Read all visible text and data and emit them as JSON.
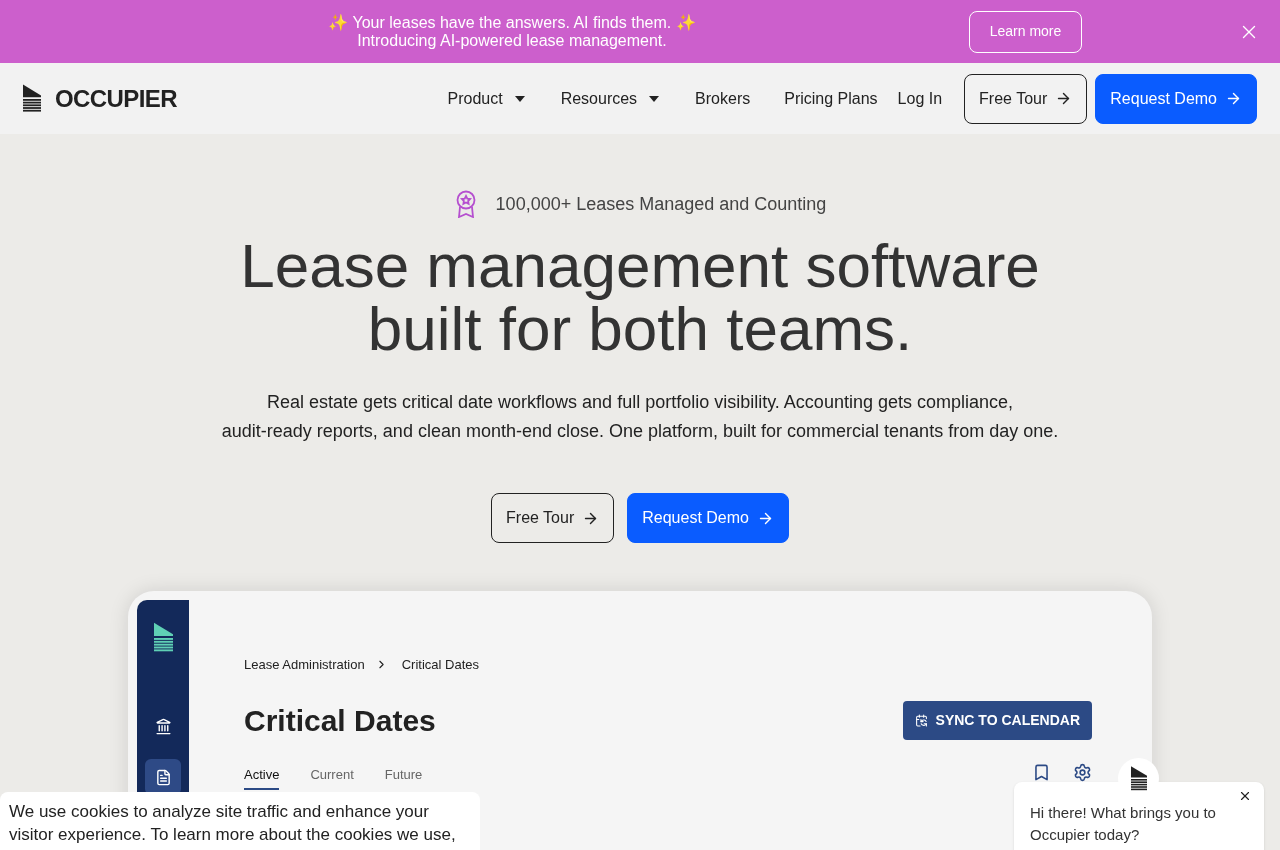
{
  "announcement": {
    "lines": [
      "✨ Your leases have the answers. AI finds them. ✨",
      "Introducing AI-powered lease management."
    ],
    "button": "Learn more"
  },
  "nav": {
    "brand": "OCCUPIER",
    "items": [
      {
        "label": "Product",
        "dropdown": true
      },
      {
        "label": "Resources",
        "dropdown": true
      },
      {
        "label": "Brokers",
        "dropdown": false
      },
      {
        "label": "Pricing Plans",
        "dropdown": false
      },
      {
        "label": "Log In",
        "dropdown": false
      }
    ],
    "buttons": [
      {
        "label": "Free Tour",
        "kind": "outline"
      },
      {
        "label": "Request Demo",
        "kind": "primary"
      }
    ]
  },
  "hero": {
    "badge": "100,000+ Leases Managed and Counting",
    "title_lines": [
      "Lease management software",
      "built for both teams."
    ],
    "subtitle_lines": [
      "Real estate gets critical date workflows and full portfolio visibility. Accounting gets compliance,",
      "audit-ready reports, and clean month-end close. One platform, built for commercial tenants from day one."
    ],
    "buttons": [
      {
        "label": "Free Tour",
        "kind": "outline"
      },
      {
        "label": "Request Demo",
        "kind": "primary"
      }
    ]
  },
  "app_preview": {
    "sidebar": [
      {
        "kind": "bank",
        "selected": false
      },
      {
        "kind": "document",
        "selected": true
      }
    ],
    "breadcrumb": [
      "Lease Administration",
      "Critical Dates"
    ],
    "title": "Critical Dates",
    "sync_button": "SYNC TO CALENDAR",
    "tabs": [
      {
        "label": "Active",
        "selected": true
      },
      {
        "label": "Current",
        "selected": false
      },
      {
        "label": "Future",
        "selected": false
      }
    ]
  },
  "cookie_notice": {
    "text": "We use cookies to analyze site traffic and enhance your visitor experience. To learn more about the cookies we use,"
  },
  "chat": {
    "message": "Hi there! What brings you to Occupier today?"
  }
}
